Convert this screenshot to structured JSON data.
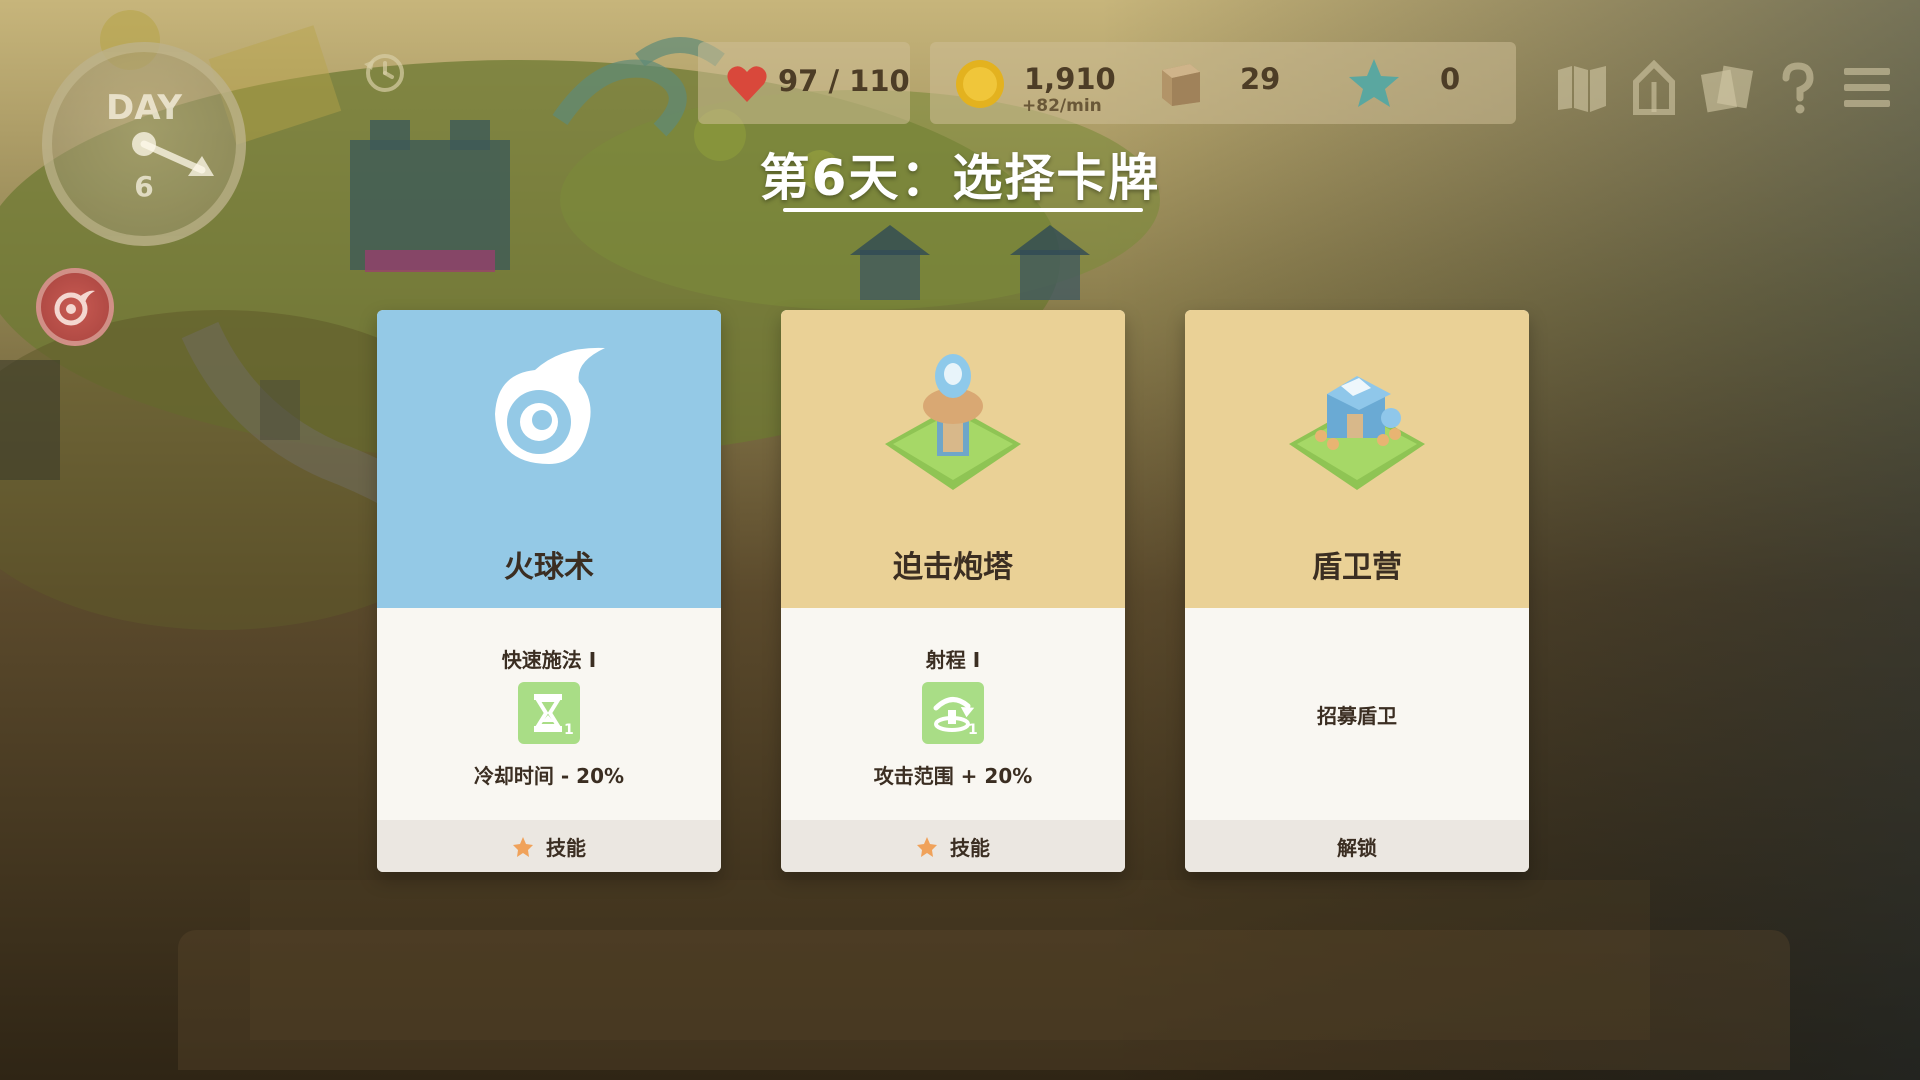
{
  "hud": {
    "day_label": "DAY",
    "day_number": "6",
    "health": "97 / 110",
    "gold": "1,910",
    "gold_rate": "+82/min",
    "wood": "29",
    "stars": "0"
  },
  "title": "第6天：选择卡牌",
  "cards": [
    {
      "name": "火球术",
      "theme": "#94c9e6",
      "perk_title": "快速施法 I",
      "perk_icon": "hourglass-icon",
      "perk_level": "1",
      "perk_effect": "冷却时间 - 20%",
      "footer": "技能"
    },
    {
      "name": "迫击炮塔",
      "theme": "#ead196",
      "perk_title": "射程 I",
      "perk_icon": "range-arrow-icon",
      "perk_level": "1",
      "perk_effect": "攻击范围 + 20%",
      "footer": "技能"
    },
    {
      "name": "盾卫营",
      "theme": "#ead196",
      "description": "招募盾卫",
      "footer": "解锁"
    }
  ],
  "colors": {
    "perk_green": "#a9dd86",
    "card_text": "#3b2e22",
    "star_orange": "#f0a25a"
  }
}
